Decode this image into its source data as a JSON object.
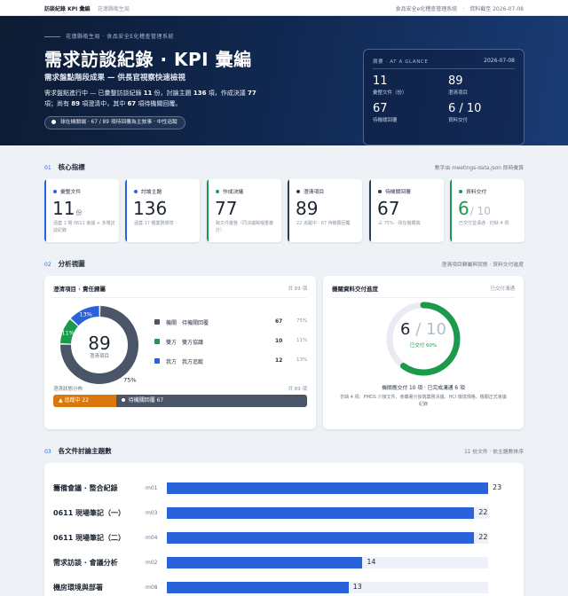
{
  "topbar": {
    "brand": "訪談紀錄 KPI 彙編",
    "brand_sub": "花蓮縣衛生局",
    "right": "食品安全e化稽查管理系統　·　資料截至 2026-07-08"
  },
  "hero": {
    "kicker": "花蓮縣衛生局 · 食品安全E化稽查管理系統",
    "title": "需求訪談紀錄 · KPI 彙編",
    "subtitle": "需求盤點階段成果 — 供長官視察快速檢視",
    "desc": {
      "p1": "需求盤點進行中 — 已彙整訪談紀錄 ",
      "v1": "11",
      "p2": " 份，討論主題 ",
      "v2": "136",
      "p3": " 項，作成決議 ",
      "v3": "77",
      "p4": " 項；尚有 ",
      "v4": "89",
      "p5": " 項澄清中，其中 ",
      "v5": "67",
      "p6": " 項待機關回覆。"
    },
    "pill": "球在機關端 · 67 / 89 項待回覆為主敘事 · 中性追蹤"
  },
  "glance": {
    "head": "摘要 · AT A GLANCE",
    "date": "2026-07-08",
    "items": [
      {
        "value": "11",
        "label": "彙整文件（份）"
      },
      {
        "value": "89",
        "label": "澄清項目"
      },
      {
        "value": "67",
        "label": "待機關回覆"
      },
      {
        "value": "6 / 10",
        "label": "資料交付"
      }
    ]
  },
  "sections": {
    "s1": {
      "num": "01",
      "title": "核心指標",
      "note": "數字由 meetings-data.json 即時彙算"
    },
    "s2": {
      "num": "02",
      "title": "分析視圖",
      "note": "澄清項目歸屬與狀態 · 資料交付進度"
    },
    "s3": {
      "num": "03",
      "title": "各文件討論主題數",
      "note": "11 份文件 · 依主題數排序"
    }
  },
  "kpis": [
    {
      "label": "彙整文件",
      "value": "11",
      "unit": "份",
      "frac": "",
      "desc": "涵蓋 1 場 0611 會議 + 多場訪談紀錄",
      "color": "#2a63d9"
    },
    {
      "label": "討論主題",
      "value": "136",
      "unit": "",
      "frac": "",
      "desc": "涵蓋 17 種業務環境",
      "color": "#2a63d9"
    },
    {
      "label": "作成決議",
      "value": "77",
      "unit": "",
      "frac": "",
      "desc": "跨文件彙整（同決議跨檔重複計）",
      "color": "#1a9a4a"
    },
    {
      "label": "澄清項目",
      "value": "89",
      "unit": "",
      "frac": "",
      "desc": "22 追蹤中 · 67 待機關回覆",
      "color": "#2f3d55"
    },
    {
      "label": "待機關回覆",
      "value": "67",
      "unit": "",
      "frac": "",
      "desc": "占 75% · 球在機關端",
      "color": "#2f3d55"
    },
    {
      "label": "資料交付",
      "value": "6",
      "unit": "",
      "frac": "/ 10",
      "desc": "已交付並溝通 · 仍缺 4 項",
      "color": "#1a9a4a"
    }
  ],
  "panel_ownership": {
    "title": "澄清項目 · 責任歸屬",
    "note": "共 89 項",
    "center_value": "89",
    "center_label": "澄清項目",
    "legend": [
      {
        "name": "機關　待機關回覆",
        "count": "67",
        "pct": "75%",
        "color": "#4a5568"
      },
      {
        "name": "雙方　雙方協議",
        "count": "10",
        "pct": "11%",
        "color": "#1a9a4a"
      },
      {
        "name": "我方　我方追蹤",
        "count": "12",
        "pct": "13%",
        "color": "#2a63d9"
      }
    ],
    "slice_labels": [
      "75%",
      "11%",
      "13%"
    ],
    "status_label": "澄清狀態分佈",
    "status_note": "共 89 項",
    "status_segments": [
      {
        "label": "▲ 追蹤中 22",
        "value": 22,
        "color": "#d9790d"
      },
      {
        "label": "待機關回覆 67",
        "value": 67,
        "color": "#4a5568"
      }
    ]
  },
  "panel_delivery": {
    "title": "機關資料交付進度",
    "note": "已交付溝通",
    "done": "6",
    "total": "/ 10",
    "ring_sub": "已交付 60%",
    "progress": 0.6,
    "line1": "機關應交付 10 項 · 已完成溝通 6 項",
    "line2": "仍缺 4 項：PMDS 介接文件、食藥署分後端業務決議、HCI 環境規格、機關正式會議紀錄"
  },
  "chart_data": {
    "type": "bar",
    "orientation": "horizontal",
    "title": "各文件討論主題數",
    "categories": [
      "籌備會議 · 整合紀錄",
      "0611 現場筆記（一）",
      "0611 現場筆記（二）",
      "需求訪談 · 會議分析",
      "機房環境與部署"
    ],
    "ids": [
      "m01",
      "m03",
      "m04",
      "m02",
      "m08"
    ],
    "values": [
      23,
      22,
      22,
      14,
      13
    ],
    "xlim": [
      0,
      23
    ],
    "color": "#2a63d9"
  }
}
